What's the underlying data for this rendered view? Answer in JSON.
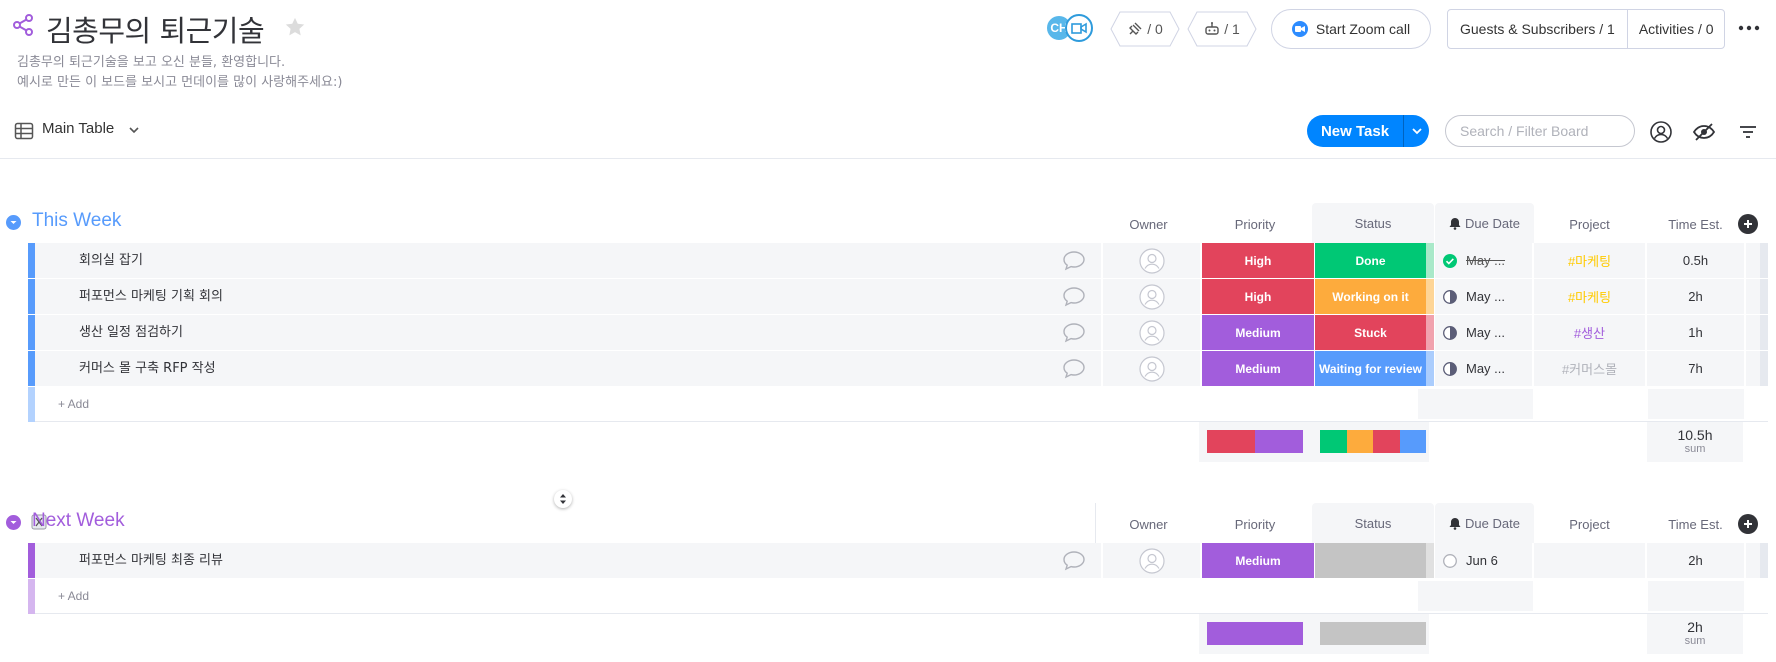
{
  "board": {
    "title": "김총무의 퇴근기술",
    "description_line1": "김총무의 퇴근기술을 보고 오신 분들, 환영합니다.",
    "description_line2": "예시로 만든 이 보드를 보시고 먼데이를 많이 사랑해주세요:)"
  },
  "header": {
    "avatar_initials": "CH",
    "integrations_count": "/ 0",
    "automations_count": "/ 1",
    "zoom_label": "Start Zoom call",
    "guests_label": "Guests & Subscribers / 1",
    "activities_label": "Activities / 0"
  },
  "toolbar": {
    "view_label": "Main Table",
    "new_task_label": "New Task",
    "search_placeholder": "Search / Filter Board"
  },
  "columns": {
    "owner": "Owner",
    "priority": "Priority",
    "status": "Status",
    "due_date": "Due Date",
    "project": "Project",
    "time_est": "Time Est."
  },
  "colors": {
    "this_week": "#579bfc",
    "next_week": "#a25ddc",
    "high": "#e2445c",
    "medium": "#a25ddc",
    "done": "#00c875",
    "working": "#fdab3d",
    "stuck": "#e2445c",
    "waiting": "#579bfc",
    "empty_status": "#c4c4c4"
  },
  "groups": [
    {
      "title": "This Week",
      "add_label": "+ Add",
      "rows": [
        {
          "name": "회의실 잡기",
          "priority": "High",
          "status": "Done",
          "due": "May ...",
          "project": "#마케팅",
          "time": "0.5h"
        },
        {
          "name": "퍼포먼스 마케팅 기획 회의",
          "priority": "High",
          "status": "Working on it",
          "due": "May ...",
          "project": "#마케팅",
          "time": "2h"
        },
        {
          "name": "생산 일정 점검하기",
          "priority": "Medium",
          "status": "Stuck",
          "due": "May ...",
          "project": "#생산",
          "time": "1h"
        },
        {
          "name": "커머스 몰 구축 RFP 작성",
          "priority": "Medium",
          "status": "Waiting for review",
          "due": "May ...",
          "project": "#커머스몰",
          "time": "7h"
        }
      ],
      "sum_value": "10.5h",
      "sum_unit": "sum",
      "priority_summary": [
        0.5,
        0.5
      ],
      "status_summary": [
        0.25,
        0.25,
        0.25,
        0.25
      ]
    },
    {
      "title": "Next Week",
      "add_label": "+ Add",
      "rows": [
        {
          "name": "퍼포먼스 마케팅 최종 리뷰",
          "priority": "Medium",
          "status": "",
          "due": "Jun 6",
          "project": "",
          "time": "2h"
        }
      ],
      "sum_value": "2h",
      "sum_unit": "sum",
      "priority_summary": [
        0,
        1
      ],
      "status_summary": [
        1
      ]
    }
  ]
}
